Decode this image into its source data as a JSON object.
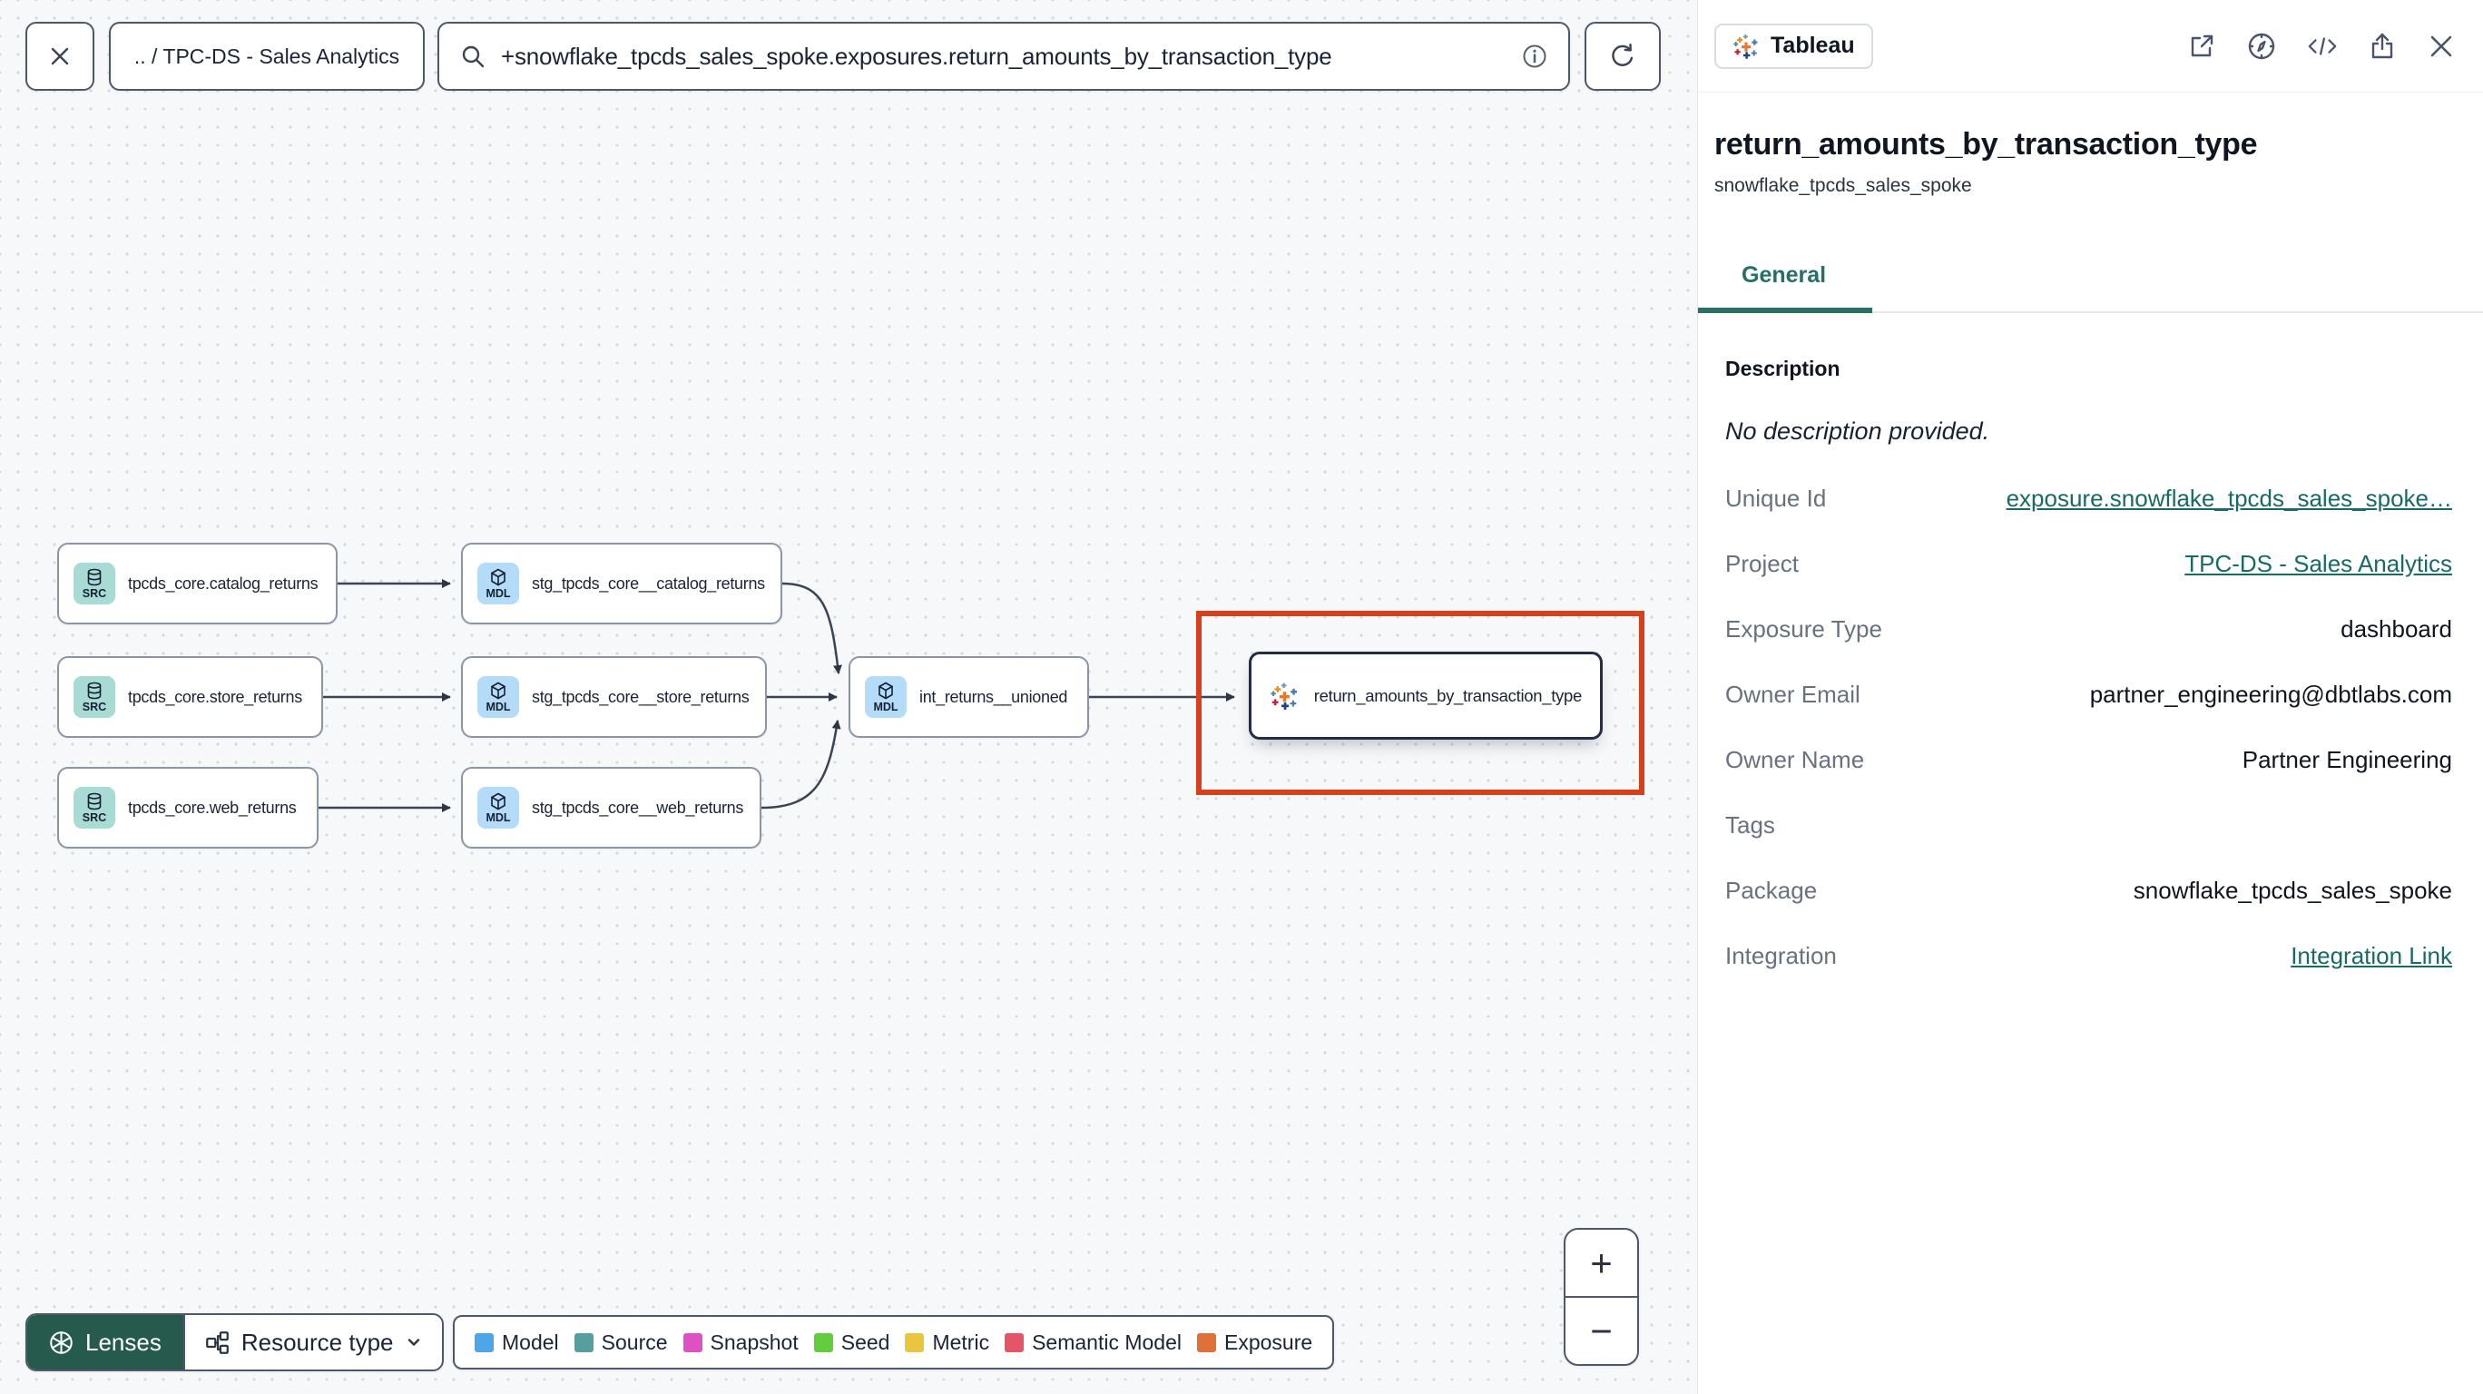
{
  "topbar": {
    "breadcrumb": ".. / TPC-DS - Sales Analytics",
    "search_value": "+snowflake_tpcds_sales_spoke.exposures.return_amounts_by_transaction_type"
  },
  "graph": {
    "badge_colors": {
      "src": "#a9dbd5",
      "mdl": "#b4dcf8"
    },
    "highlight_color": "#d8401c",
    "nodes": {
      "src_catalog": {
        "badge": "SRC",
        "label": "tpcds_core.catalog_returns"
      },
      "stg_catalog": {
        "badge": "MDL",
        "label": "stg_tpcds_core__catalog_returns"
      },
      "src_store": {
        "badge": "SRC",
        "label": "tpcds_core.store_returns"
      },
      "stg_store": {
        "badge": "MDL",
        "label": "stg_tpcds_core__store_returns"
      },
      "int_unioned": {
        "badge": "MDL",
        "label": "int_returns__unioned"
      },
      "src_web": {
        "badge": "SRC",
        "label": "tpcds_core.web_returns"
      },
      "stg_web": {
        "badge": "MDL",
        "label": "stg_tpcds_core__web_returns"
      },
      "exposure": {
        "label": "return_amounts_by_transaction_type"
      }
    }
  },
  "footer": {
    "lenses_label": "Lenses",
    "resource_type_label": "Resource type",
    "legend": [
      {
        "label": "Model",
        "color": "#4da6e8"
      },
      {
        "label": "Source",
        "color": "#569f9f"
      },
      {
        "label": "Snapshot",
        "color": "#de50c4"
      },
      {
        "label": "Seed",
        "color": "#62ce3e"
      },
      {
        "label": "Metric",
        "color": "#e9c63f"
      },
      {
        "label": "Semantic Model",
        "color": "#e5556a"
      },
      {
        "label": "Exposure",
        "color": "#e0703a"
      }
    ]
  },
  "zoom_controls": {
    "zoom_in": "+",
    "zoom_out": "−"
  },
  "panel": {
    "integration_badge": "Tableau",
    "title": "return_amounts_by_transaction_type",
    "subtitle": "snowflake_tpcds_sales_spoke",
    "tabs": [
      {
        "label": "General"
      }
    ],
    "description_heading": "Description",
    "description_empty": "No description provided.",
    "accent_colors": {
      "link": "#196a66",
      "tab": "#266f68"
    },
    "fields": [
      {
        "label": "Unique Id",
        "value": "exposure.snowflake_tpcds_sales_spoke…"
      },
      {
        "label": "Project",
        "value": "TPC-DS - Sales Analytics"
      },
      {
        "label": "Exposure Type",
        "value": "dashboard"
      },
      {
        "label": "Owner Email",
        "value": "partner_engineering@dbtlabs.com"
      },
      {
        "label": "Owner Name",
        "value": "Partner Engineering"
      },
      {
        "label": "Tags",
        "value": ""
      },
      {
        "label": "Package",
        "value": "snowflake_tpcds_sales_spoke"
      },
      {
        "label": "Integration",
        "value": "Integration Link"
      }
    ]
  }
}
